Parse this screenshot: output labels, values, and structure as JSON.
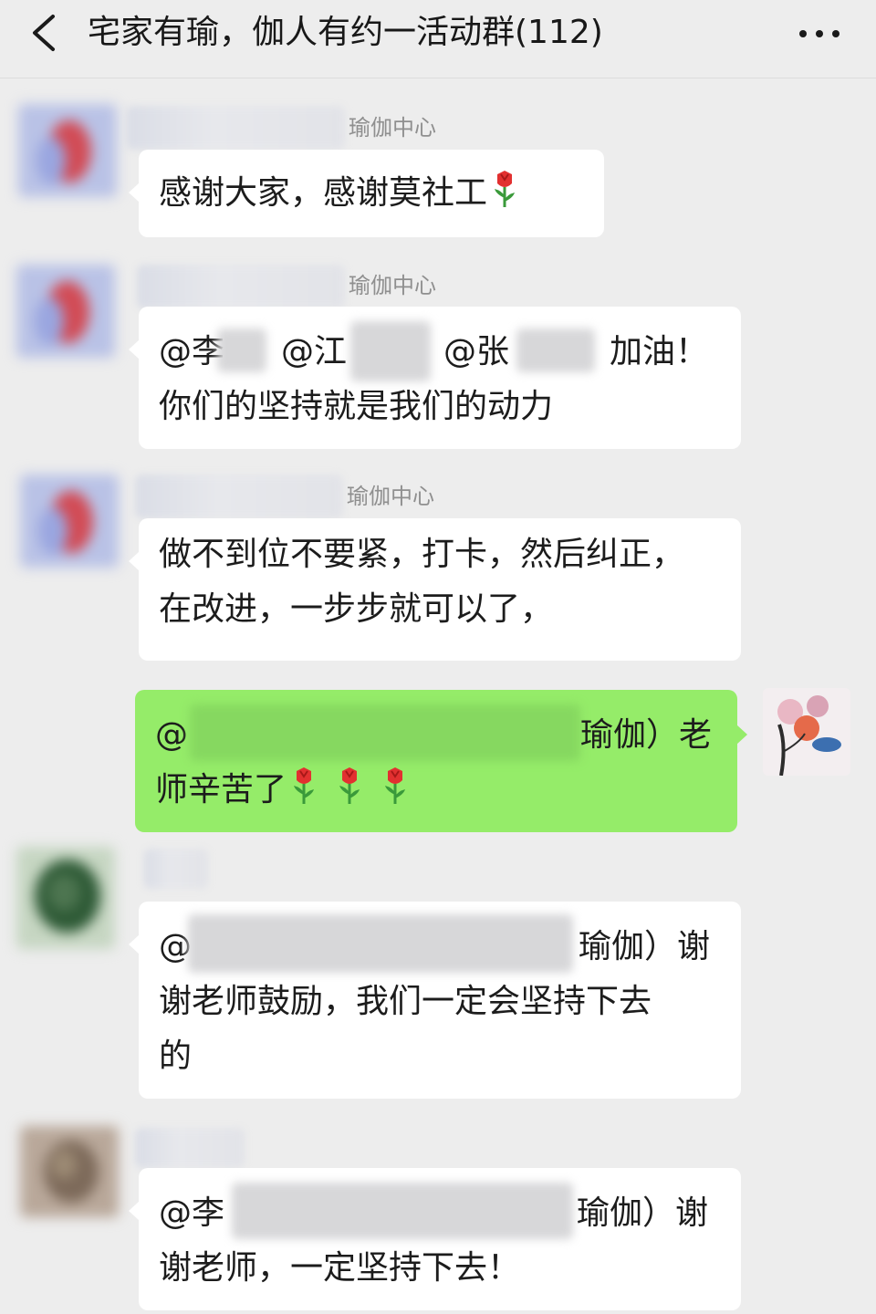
{
  "header": {
    "title": "宅家有瑜，伽人有约一活动群(112)"
  },
  "messages": [
    {
      "sender_suffix": "瑜伽中心",
      "text": "感谢大家，感谢莫社工"
    },
    {
      "sender_suffix": "瑜伽中心",
      "mention1": "@李",
      "mention2": "@江",
      "mention3": "@张",
      "cheer": "加油！",
      "line2": "你们的坚持就是我们的动力"
    },
    {
      "sender_suffix": "瑜伽中心",
      "line1": "做不到位不要紧，打卡，然后纠正，",
      "line2": "在改进，一步步就可以了，"
    },
    {
      "mine": true,
      "at": "@",
      "line1_tail": "瑜伽）老",
      "line2": "师辛苦了"
    },
    {
      "at": "@",
      "line1_tail": "瑜伽）谢",
      "line2": "谢老师鼓励，我们一定会坚持下去",
      "line3": "的"
    },
    {
      "at": "@李",
      "line1_tail": "瑜伽）谢",
      "line2": "谢老师，一定坚持下去！"
    }
  ],
  "colors": {
    "background": "#ededed",
    "bubble_other": "#ffffff",
    "bubble_mine": "#95ec69"
  },
  "icons": [
    "back-chevron-icon",
    "more-dots-icon",
    "rose-emoji-icon"
  ]
}
